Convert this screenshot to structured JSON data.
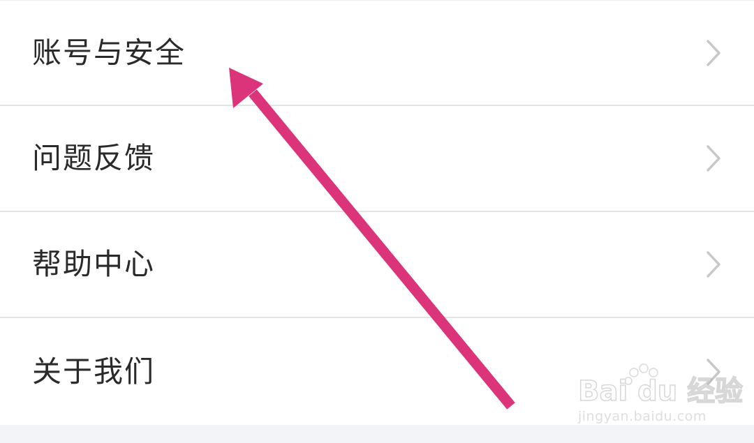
{
  "menu": {
    "items": [
      {
        "label": "账号与安全",
        "chevron": "chevron-right-icon"
      },
      {
        "label": "问题反馈",
        "chevron": "chevron-right-icon"
      },
      {
        "label": "帮助中心",
        "chevron": "chevron-right-icon"
      },
      {
        "label": "关于我们",
        "chevron": "chevron-right-icon"
      }
    ]
  },
  "annotation": {
    "icon": "arrow-icon",
    "color": "#dc347a"
  },
  "watermark": {
    "brand": "Bai du 经验",
    "url": "jingyan.baidu.com"
  },
  "colors": {
    "background": "#f3f4f7",
    "row_background": "#ffffff",
    "divider": "#e3e3e3",
    "text": "#2a2a2a",
    "chevron": "#c8c8c8"
  }
}
